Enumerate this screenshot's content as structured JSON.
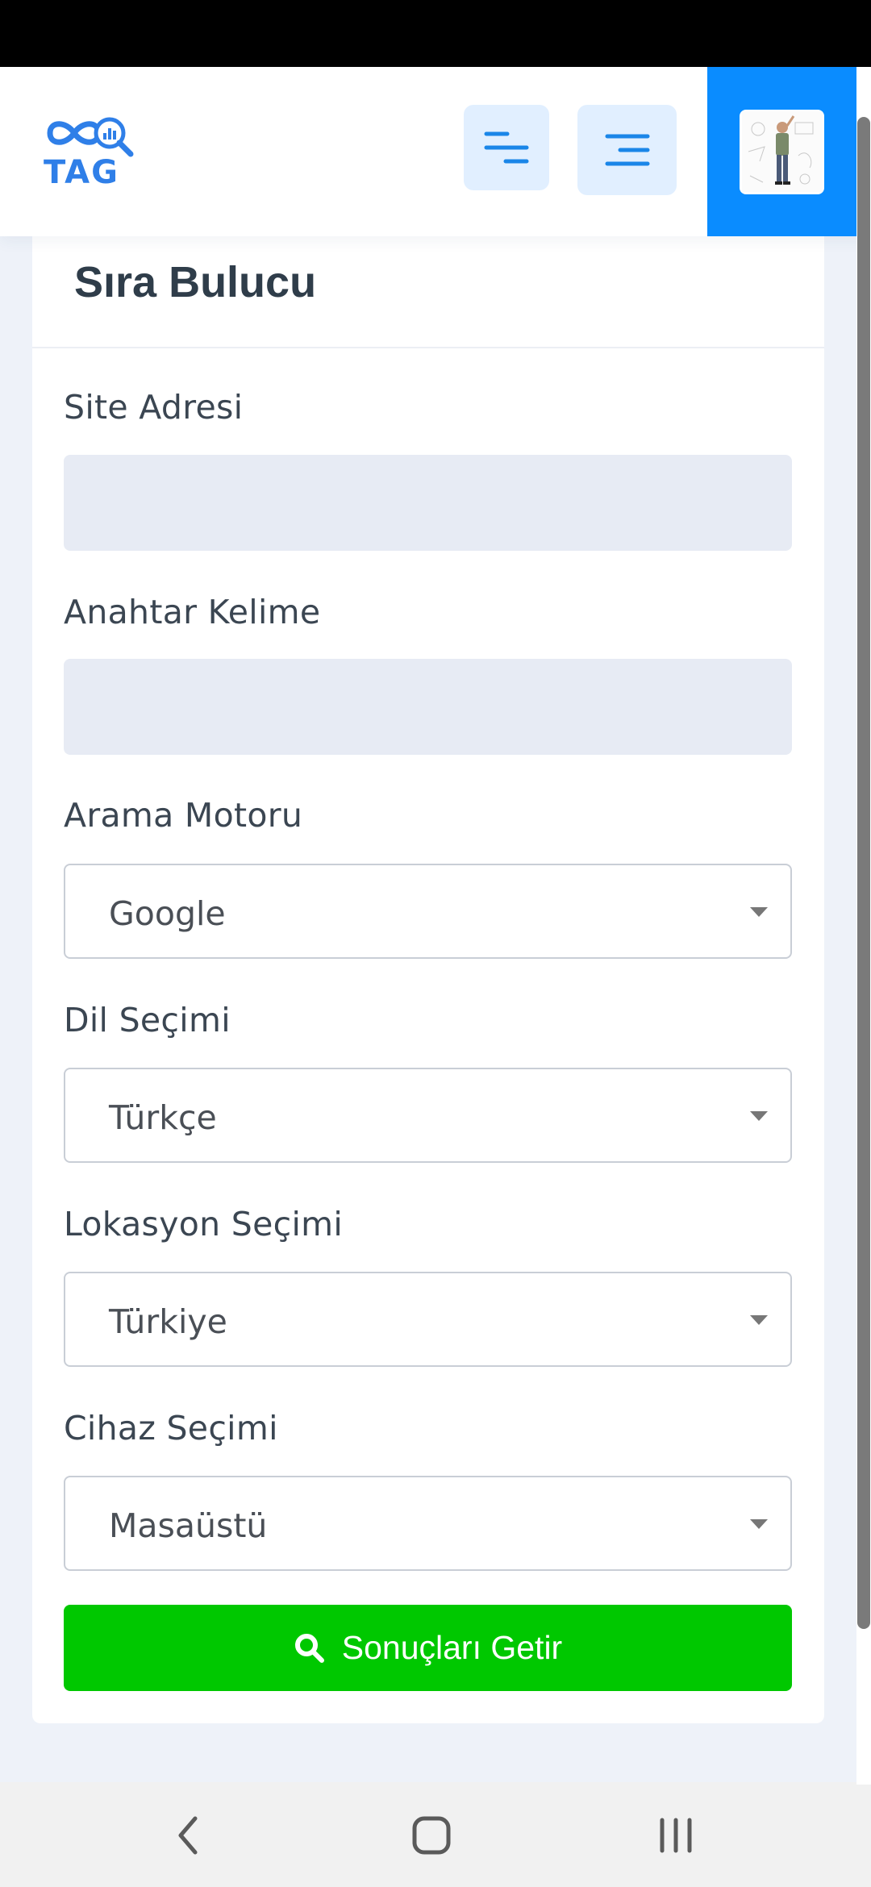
{
  "header": {
    "logo_text": "TAG",
    "sidebar_toggle_icon": "menu-left-icon",
    "menu_toggle_icon": "menu-right-icon",
    "avatar_icon": "user-avatar"
  },
  "card": {
    "title": "Sıra Bulucu",
    "fields": {
      "site": {
        "label": "Site Adresi",
        "value": "",
        "placeholder": ""
      },
      "keyword": {
        "label": "Anahtar Kelime",
        "value": "",
        "placeholder": ""
      },
      "engine": {
        "label": "Arama Motoru",
        "selected": "Google"
      },
      "language": {
        "label": "Dil Seçimi",
        "selected": "Türkçe"
      },
      "location": {
        "label": "Lokasyon Seçimi",
        "selected": "Türkiye"
      },
      "device": {
        "label": "Cihaz Seçimi",
        "selected": "Masaüstü"
      }
    },
    "submit_label": "Sonuçları Getir",
    "submit_icon": "search-icon"
  },
  "colors": {
    "accent": "#0a8cff",
    "submit": "#00c800",
    "logo": "#2f7fe8"
  }
}
